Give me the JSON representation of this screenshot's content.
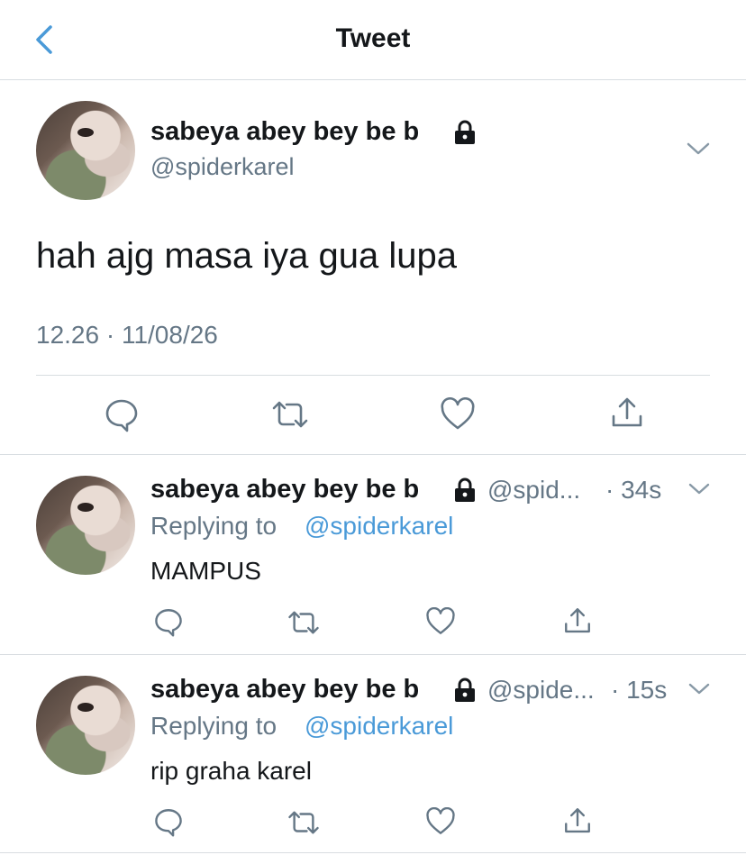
{
  "header": {
    "title": "Tweet"
  },
  "main_tweet": {
    "display_name": "sabeya abey bey be b",
    "handle": "@spiderkarel",
    "text": "hah ajg masa iya gua lupa",
    "timestamp": "12.26 · 11/08/26"
  },
  "replies": [
    {
      "display_name": "sabeya abey bey be b",
      "handle": "@spid...",
      "time": "· 34s",
      "replying_prefix": "Replying to",
      "replying_handle": "@spiderkarel",
      "text": "MAMPUS"
    },
    {
      "display_name": "sabeya abey bey be b",
      "handle": "@spide...",
      "time": "· 15s",
      "replying_prefix": "Replying to",
      "replying_handle": "@spiderkarel",
      "text": "rip graha karel"
    }
  ],
  "icons": {
    "back": "chevron-left-icon",
    "lock": "lock-icon",
    "more": "chevron-down-icon",
    "reply": "reply-icon",
    "retweet": "retweet-icon",
    "like": "heart-icon",
    "share": "share-icon"
  },
  "colors": {
    "accent": "#4a9ad8",
    "secondary_text": "#657786",
    "divider": "#d8dde1"
  }
}
